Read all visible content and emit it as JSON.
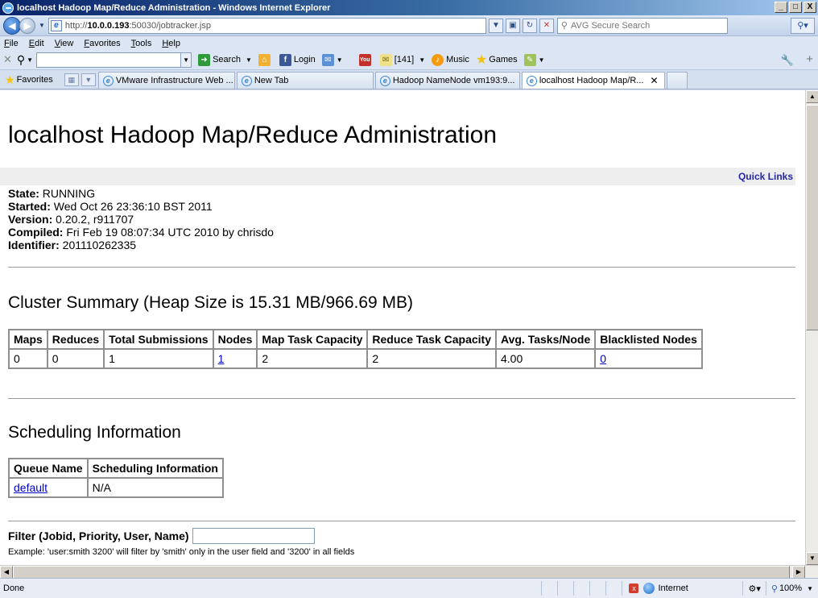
{
  "window": {
    "title": "localhost Hadoop Map/Reduce Administration - Windows Internet Explorer",
    "minimize": "_",
    "maximize": "□",
    "close": "X"
  },
  "address": {
    "url_prefix": "http://",
    "url_host": "10.0.0.193",
    "url_rest": ":50030/jobtracker.jsp",
    "search_placeholder": "AVG Secure Search"
  },
  "menu": [
    "File",
    "Edit",
    "View",
    "Favorites",
    "Tools",
    "Help"
  ],
  "toolbar": {
    "search_label": "Search",
    "login_label": "Login",
    "counter_label": "[141]",
    "music_label": "Music",
    "games_label": "Games"
  },
  "favorites_label": "Favorites",
  "tabs": [
    {
      "label": "VMware Infrastructure Web ...",
      "active": false
    },
    {
      "label": "New Tab",
      "active": false
    },
    {
      "label": "Hadoop NameNode vm193:9...",
      "active": false
    },
    {
      "label": "localhost Hadoop Map/R...",
      "active": true
    }
  ],
  "page": {
    "heading": "localhost Hadoop Map/Reduce Administration",
    "quick_links": "Quick Links",
    "info": [
      {
        "label": "State:",
        "value": " RUNNING"
      },
      {
        "label": "Started:",
        "value": " Wed Oct 26 23:36:10 BST 2011"
      },
      {
        "label": "Version:",
        "value": " 0.20.2, r911707"
      },
      {
        "label": "Compiled:",
        "value": " Fri Feb 19 08:07:34 UTC 2010 by chrisdo"
      },
      {
        "label": "Identifier:",
        "value": " 201110262335"
      }
    ],
    "cluster_summary_title": "Cluster Summary (Heap Size is 15.31 MB/966.69 MB)",
    "cluster_table": {
      "headers": [
        "Maps",
        "Reduces",
        "Total Submissions",
        "Nodes",
        "Map Task Capacity",
        "Reduce Task Capacity",
        "Avg. Tasks/Node",
        "Blacklisted Nodes"
      ],
      "row": [
        "0",
        "0",
        "1",
        "1",
        "2",
        "2",
        "4.00",
        "0"
      ]
    },
    "scheduling_title": "Scheduling Information",
    "scheduling_table": {
      "headers": [
        "Queue Name",
        "Scheduling Information"
      ],
      "row": [
        "default",
        "N/A"
      ]
    },
    "filter_label": "Filter (Jobid, Priority, User, Name)",
    "filter_value": "",
    "example_text": "Example: 'user:smith 3200' will filter by 'smith' only in the user field and '3200' in all fields"
  },
  "status": {
    "text": "Done",
    "zone": "Internet",
    "zoom": "100%"
  }
}
